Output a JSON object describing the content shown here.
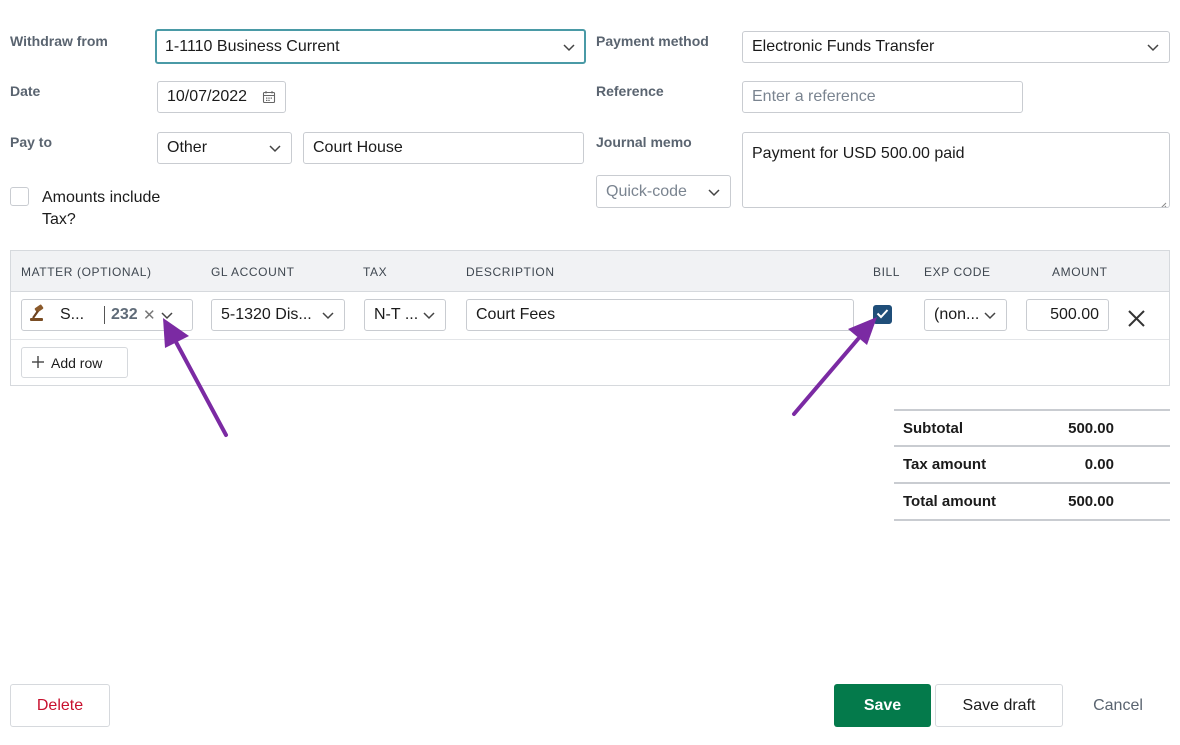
{
  "header": {
    "withdraw_label": "Withdraw from",
    "withdraw_value": "1-1110 Business Current",
    "payment_label": "Payment method",
    "payment_value": "Electronic Funds Transfer",
    "date_label": "Date",
    "date_value": "10/07/2022",
    "reference_label": "Reference",
    "reference_placeholder": "Enter a reference",
    "payto_label": "Pay to",
    "payto_type": "Other",
    "payto_name": "Court House",
    "memo_label": "Journal memo",
    "memo_value": "Payment for USD 500.00 paid",
    "quickcode_placeholder": "Quick-code",
    "amounts_tax_label_1": "Amounts include",
    "amounts_tax_label_2": "Tax?"
  },
  "grid": {
    "columns": [
      "MATTER (OPTIONAL)",
      "GL ACCOUNT",
      "TAX",
      "DESCRIPTION",
      "BILL",
      "EXP CODE",
      "AMOUNT"
    ],
    "row": {
      "matter_name": "S...",
      "matter_number": "232",
      "gl_account": "5-1320 Dis...",
      "tax": "N-T ...",
      "description": "Court Fees",
      "bill_checked": true,
      "exp_code": "(non...",
      "amount": "500.00"
    },
    "add_row_label": "Add row"
  },
  "totals": {
    "subtotal_label": "Subtotal",
    "subtotal_value": "500.00",
    "tax_label": "Tax amount",
    "tax_value": "0.00",
    "total_label": "Total amount",
    "total_value": "500.00"
  },
  "footer": {
    "delete_label": "Delete",
    "save_label": "Save",
    "save_draft_label": "Save draft",
    "cancel_label": "Cancel"
  },
  "colors": {
    "accent_focus": "#4a9aa6",
    "save_button": "#047a4b",
    "delete_text": "#c8102e",
    "checkbox_checked": "#1f4e79",
    "annotation_arrow": "#7b2aa3"
  },
  "icons": [
    "chevron-down-icon",
    "calendar-icon",
    "gavel-icon",
    "clear-icon",
    "plus-icon",
    "delete-row-icon",
    "checkmark-icon",
    "annotation-arrow"
  ]
}
